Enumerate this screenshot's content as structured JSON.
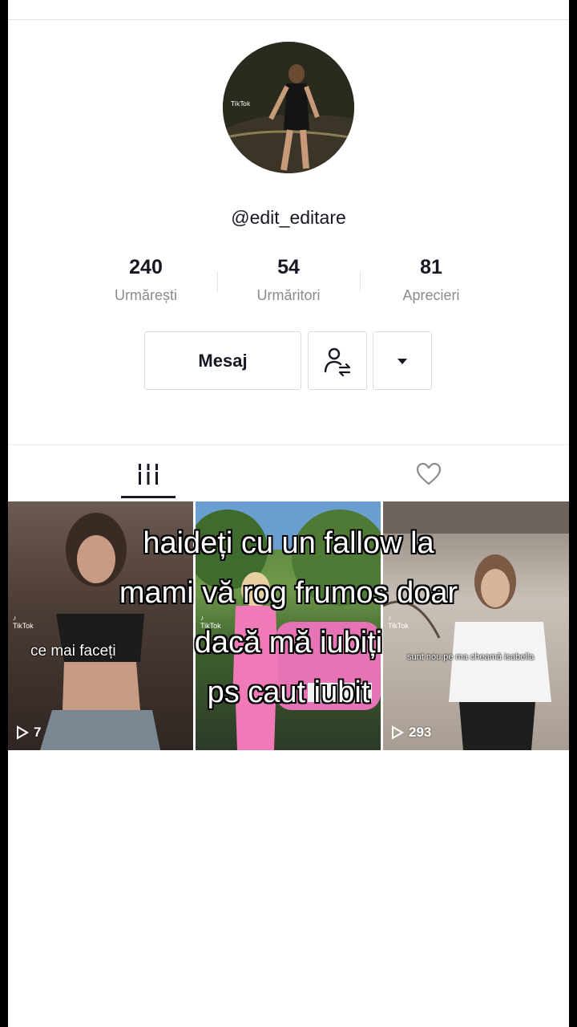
{
  "profile": {
    "username": "@edit_editare",
    "avatar_alt": "profile-photo"
  },
  "stats": [
    {
      "value": "240",
      "label": "Urmărești"
    },
    {
      "value": "54",
      "label": "Urmăritori"
    },
    {
      "value": "81",
      "label": "Aprecieri"
    }
  ],
  "actions": {
    "message_label": "Mesaj",
    "follow_icon": "user-swap-icon",
    "more_icon": "caret-down-icon"
  },
  "tabs": {
    "videos_icon": "grid-icon",
    "liked_icon": "heart-icon"
  },
  "videos": [
    {
      "caption": "ce mai faceți",
      "plays": "7"
    },
    {
      "caption": "",
      "plays": ""
    },
    {
      "caption": "sunt nou pe ma cheamă isabella",
      "plays": "293"
    }
  ],
  "overlay_text": [
    "haideți cu un fallow la",
    "mami vă rog frumos doar",
    "dacă mă iubiți",
    "ps caut iubit"
  ],
  "colors": {
    "text_primary": "#161823",
    "text_secondary": "#8a8b91",
    "border": "#dcdcdc"
  }
}
